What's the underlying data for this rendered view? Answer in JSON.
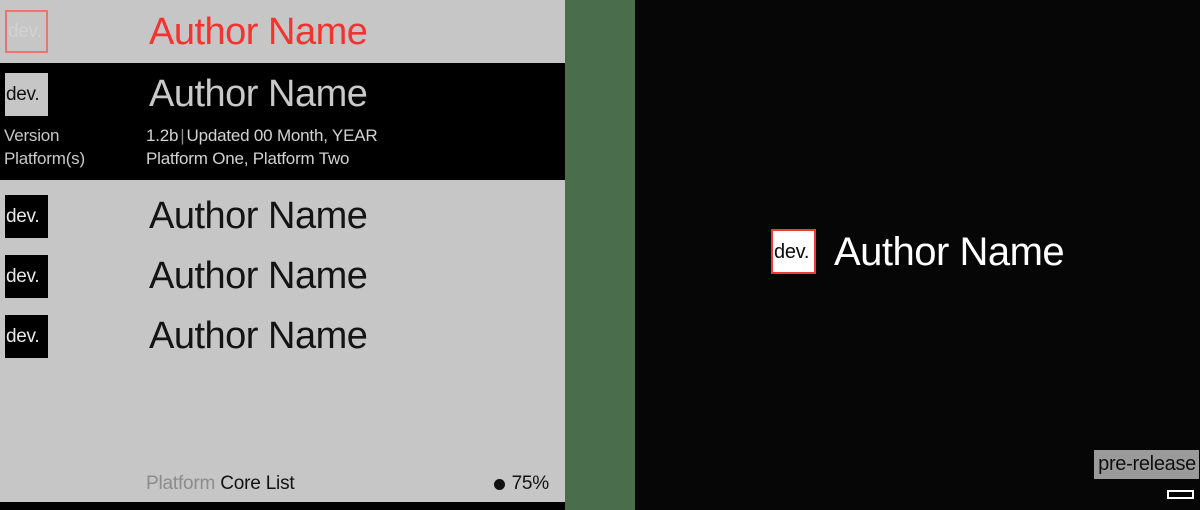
{
  "left_panel": {
    "hero_row": {
      "badge_text": "dev.",
      "title": "Author Name"
    },
    "featured": {
      "badge_text": "dev.",
      "title": "Author Name",
      "meta": [
        {
          "label": "Version",
          "value_main": "1.2b",
          "separator": "|",
          "value_rest": "Updated 00 Month, YEAR"
        },
        {
          "label": "Platform(s)",
          "value_main": "Platform One, Platform Two",
          "separator": "",
          "value_rest": ""
        }
      ]
    },
    "rows": [
      {
        "badge_text": "dev.",
        "title": "Author Name"
      },
      {
        "badge_text": "dev.",
        "title": "Author Name"
      },
      {
        "badge_text": "dev.",
        "title": "Author Name"
      }
    ],
    "footer": {
      "caption_muted": "Platform",
      "caption_strong": "Core List",
      "progress_icon": "filled-circle-icon",
      "progress_value": "75%"
    }
  },
  "divider": {
    "color": "#4a6e4c"
  },
  "right_panel": {
    "badge_text": "dev.",
    "title": "Author Name",
    "prerelease_label": "pre-release",
    "minimize_icon": "minimize-icon"
  },
  "colors": {
    "panel_background": "#c6c6c6",
    "featured_background": "#000000",
    "accent_red": "#f4332f",
    "badge_outline_red": "#f2726f",
    "divider_green": "#4a6e4c",
    "right_background": "#060606",
    "prerelease_background": "#9a9a9a"
  }
}
